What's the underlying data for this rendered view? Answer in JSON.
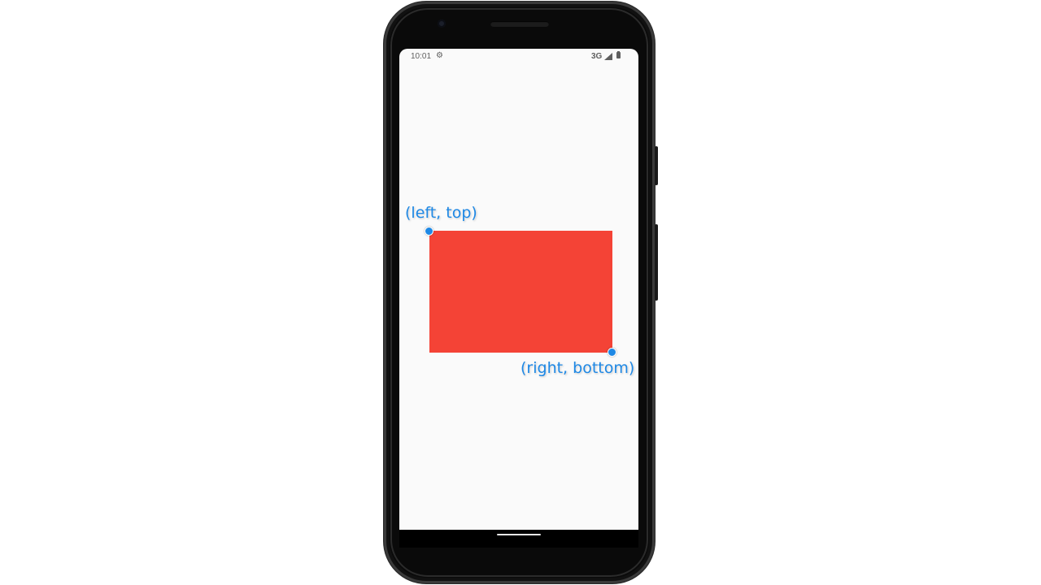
{
  "status_bar": {
    "time": "10:01",
    "settings_icon": "gear-icon",
    "network": "3G",
    "signal_icon": "cell-signal-icon",
    "battery_icon": "battery-icon"
  },
  "canvas": {
    "rect_color": "#f44336",
    "marker_color": "#1e88e5",
    "top_left_label": "(left, top)",
    "bottom_right_label": "(right, bottom)"
  },
  "nav_bar": {
    "home_icon": "home-pill-icon"
  }
}
